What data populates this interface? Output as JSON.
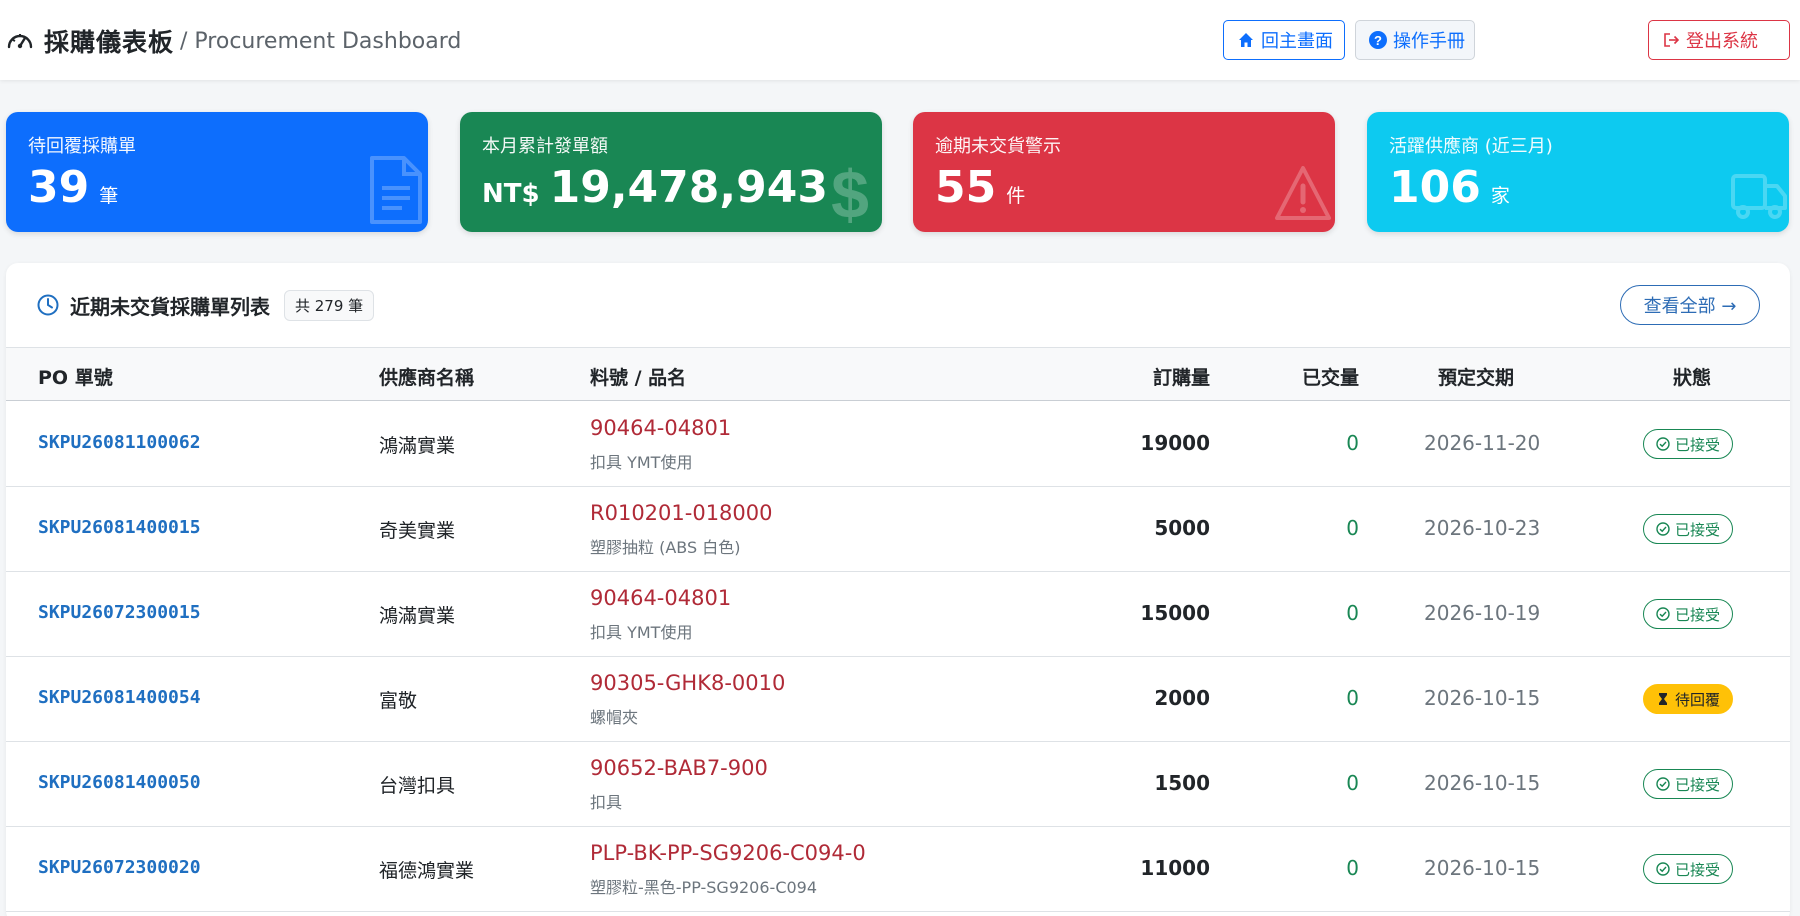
{
  "header": {
    "title": "採購儀表板",
    "subtitle": "/ Procurement Dashboard",
    "home_label": "回主畫面",
    "manual_label": "操作手冊",
    "logout_label": "登出系統"
  },
  "cards": [
    {
      "label": "待回覆採購單",
      "prefix": "",
      "value": "39",
      "unit": "筆",
      "color": "#0d6efd",
      "icon": "document-icon"
    },
    {
      "label": "本月累計發單額",
      "prefix": "NT$",
      "value": "19,478,943",
      "unit": "",
      "color": "#198754",
      "icon": "dollar-icon"
    },
    {
      "label": "逾期未交貨警示",
      "prefix": "",
      "value": "55",
      "unit": "件",
      "color": "#dc3545",
      "icon": "warning-icon"
    },
    {
      "label": "活躍供應商 (近三月)",
      "prefix": "",
      "value": "106",
      "unit": "家",
      "color": "#0dcaf0",
      "icon": "truck-icon"
    }
  ],
  "panel": {
    "title": "近期未交貨採購單列表",
    "count_badge": "共 279 筆",
    "view_all_label": "查看全部 →"
  },
  "table": {
    "headers": {
      "po": "PO 單號",
      "vendor": "供應商名稱",
      "part": "料號 / 品名",
      "qty": "訂購量",
      "done": "已交量",
      "date": "預定交期",
      "status": "狀態"
    },
    "rows": [
      {
        "po": "SKPU26081100062",
        "vendor": "鴻滿實業",
        "part_no": "90464-04801",
        "part_name": "扣具 YMT使用",
        "qty": "19000",
        "done": "0",
        "date": "2026-11-20",
        "status": "已接受",
        "status_type": "ok"
      },
      {
        "po": "SKPU26081400015",
        "vendor": "奇美實業",
        "part_no": "R010201-018000",
        "part_name": "塑膠抽粒 (ABS 白色)",
        "qty": "5000",
        "done": "0",
        "date": "2026-10-23",
        "status": "已接受",
        "status_type": "ok"
      },
      {
        "po": "SKPU26072300015",
        "vendor": "鴻滿實業",
        "part_no": "90464-04801",
        "part_name": "扣具 YMT使用",
        "qty": "15000",
        "done": "0",
        "date": "2026-10-19",
        "status": "已接受",
        "status_type": "ok"
      },
      {
        "po": "SKPU26081400054",
        "vendor": "富敬",
        "part_no": "90305-GHK8-0010",
        "part_name": "螺帽夾",
        "qty": "2000",
        "done": "0",
        "date": "2026-10-15",
        "status": "待回覆",
        "status_type": "wait"
      },
      {
        "po": "SKPU26081400050",
        "vendor": "台灣扣具",
        "part_no": "90652-BAB7-900",
        "part_name": "扣具",
        "qty": "1500",
        "done": "0",
        "date": "2026-10-15",
        "status": "已接受",
        "status_type": "ok"
      },
      {
        "po": "SKPU26072300020",
        "vendor": "福德鴻實業",
        "part_no": "PLP-BK-PP-SG9206-C094-0",
        "part_name": "塑膠粒-黑色-PP-SG9206-C094",
        "qty": "11000",
        "done": "0",
        "date": "2026-10-15",
        "status": "已接受",
        "status_type": "ok"
      }
    ]
  },
  "colors": {
    "primary": "#0d6efd",
    "success": "#198754",
    "danger": "#dc3545",
    "info": "#0dcaf0",
    "warning": "#ffc107",
    "part_no": "#b02a37",
    "po_link": "#1f6fc1"
  }
}
